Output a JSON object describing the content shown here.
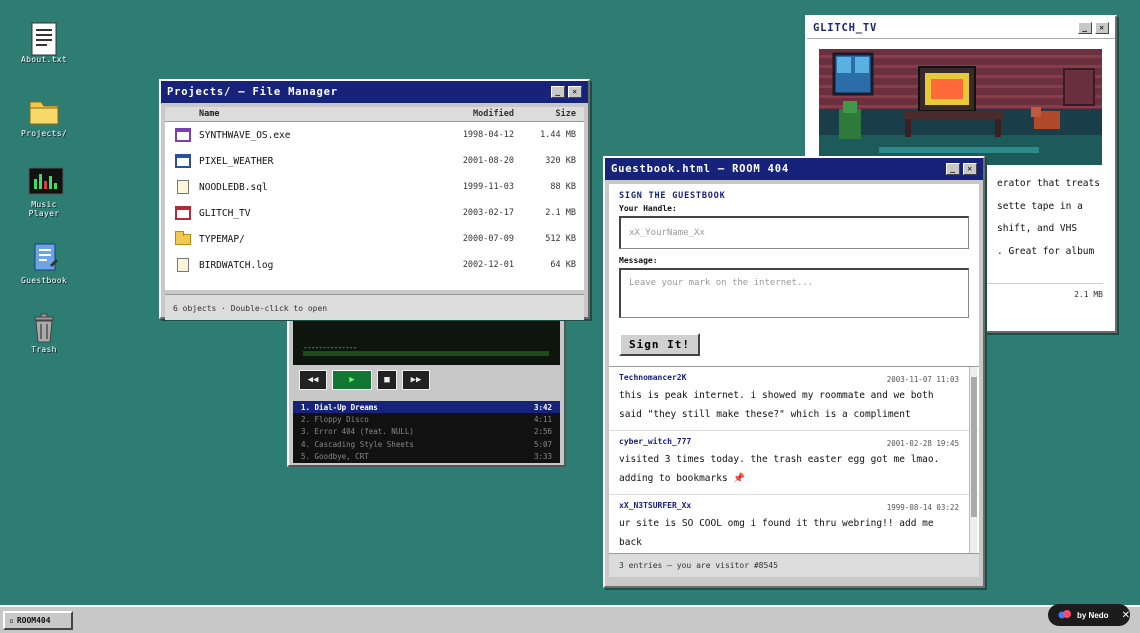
{
  "desktop": {
    "icons": [
      {
        "label": "About.txt"
      },
      {
        "label": "Projects/"
      },
      {
        "label": "Music Player"
      },
      {
        "label": "Guestbook"
      },
      {
        "label": "Trash"
      }
    ]
  },
  "file_manager": {
    "title": "Projects/ — File Manager",
    "columns": {
      "name": "Name",
      "modified": "Modified",
      "size": "Size"
    },
    "files": [
      {
        "name": "SYNTHWAVE_OS.exe",
        "modified": "1998-04-12",
        "size": "1.44 MB",
        "type": "app",
        "color": "#7a3fb0"
      },
      {
        "name": "PIXEL_WEATHER",
        "modified": "2001-08-20",
        "size": "320 KB",
        "type": "app",
        "color": "#2a4ea0"
      },
      {
        "name": "NOODLEDB.sql",
        "modified": "1999-11-03",
        "size": "88 KB",
        "type": "doc",
        "color": "#777777"
      },
      {
        "name": "GLITCH_TV",
        "modified": "2003-02-17",
        "size": "2.1 MB",
        "type": "app",
        "color": "#b02a3a"
      },
      {
        "name": "TYPEMAP/",
        "modified": "2000-07-09",
        "size": "512 KB",
        "type": "folder",
        "color": "#f2c94c"
      },
      {
        "name": "BIRDWATCH.log",
        "modified": "2002-12-01",
        "size": "64 KB",
        "type": "doc",
        "color": "#777777"
      }
    ],
    "status": "6 objects · Double-click to open"
  },
  "music_player": {
    "visualizer": "--------------",
    "buttons": {
      "rewind": "◀◀",
      "play": "▶",
      "stop": "■",
      "forward": "▶▶"
    },
    "tracks": [
      {
        "title": "1. Dial-Up Dreams",
        "time": "3:42"
      },
      {
        "title": "2. Floppy Disco",
        "time": "4:11"
      },
      {
        "title": "3. Error 404 (feat. NULL)",
        "time": "2:56"
      },
      {
        "title": "4. Cascading Style Sheets",
        "time": "5:07"
      },
      {
        "title": "5. Goodbye, CRT",
        "time": "3:33"
      }
    ]
  },
  "glitch_tv": {
    "title": "GLITCH_TV",
    "description_lines": [
      "erator that treats",
      "sette tape in a",
      " shift, and VHS",
      ". Great for album"
    ],
    "size": "2.1 MB"
  },
  "guestbook": {
    "title": "Guestbook.html — ROOM 404",
    "form_title": "SIGN THE GUESTBOOK",
    "handle_label": "Your Handle:",
    "handle_placeholder": "xX_YourName_Xx",
    "message_label": "Message:",
    "message_placeholder": "Leave your mark on the internet...",
    "submit_label": "Sign It!",
    "entries": [
      {
        "author": "Technomancer2K",
        "date": "2003-11-07 11:03",
        "text": "this is peak internet. i showed my roommate and we both said \"they still make these?\" which is a compliment"
      },
      {
        "author": "cyber_witch_777",
        "date": "2001-02-28 19:45",
        "text": "visited 3 times today. the trash easter egg got me lmao. adding to bookmarks 📌"
      },
      {
        "author": "xX_N3TSURFER_Xx",
        "date": "1999-08-14 03:22",
        "text": "ur site is SO COOL omg i found it thru webring!! add me back"
      }
    ],
    "status": "3 entries — you are visitor #8545"
  },
  "taskbar": {
    "start_label": "ROOM404"
  },
  "badge": {
    "label": "by Nedo",
    "close": "✕"
  }
}
